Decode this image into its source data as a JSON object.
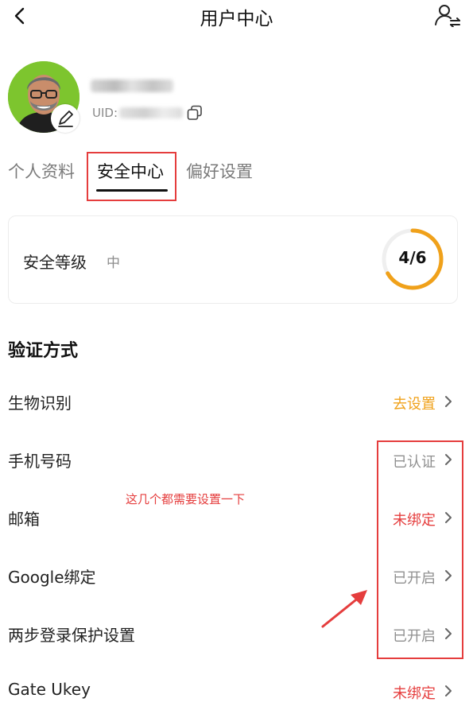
{
  "nav": {
    "title": "用户中心"
  },
  "profile": {
    "uid_label": "UID:"
  },
  "tabs": [
    {
      "label": "个人资料"
    },
    {
      "label": "安全中心"
    },
    {
      "label": "偏好设置"
    }
  ],
  "security": {
    "label": "安全等级",
    "level": "中",
    "score_text": "4/6",
    "score": 4,
    "max": 6
  },
  "verification": {
    "title": "验证方式",
    "items": [
      {
        "label": "生物识别",
        "status": "去设置",
        "tone": "orange"
      },
      {
        "label": "手机号码",
        "status": "已认证",
        "tone": "gray"
      },
      {
        "label": "邮箱",
        "status": "未绑定",
        "tone": "red"
      },
      {
        "label": "Google绑定",
        "status": "已开启",
        "tone": "gray"
      },
      {
        "label": "两步登录保护设置",
        "status": "已开启",
        "tone": "gray"
      },
      {
        "label": "Gate Ukey",
        "status": "未绑定",
        "tone": "red"
      }
    ]
  },
  "annotation": {
    "note": "这几个都需要设置一下"
  },
  "colors": {
    "accent_orange": "#f0a11a",
    "alert_red": "#e53d3d",
    "avatar_bg": "#7dc52e"
  }
}
